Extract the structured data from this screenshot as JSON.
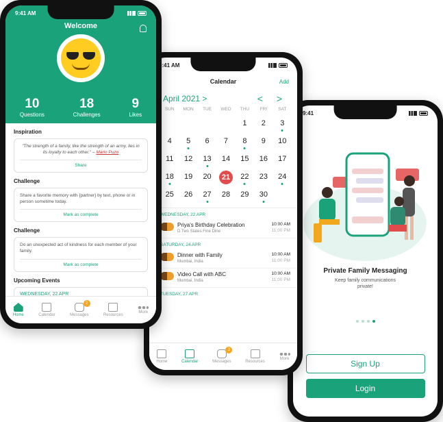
{
  "colors": {
    "accent": "#1aa37a",
    "today": "#e24b4b",
    "badge": "#f5a623"
  },
  "phone1": {
    "status_time": "9:41 AM",
    "title": "Welcome",
    "stats": [
      {
        "value": "10",
        "label": "Questions"
      },
      {
        "value": "18",
        "label": "Challenges"
      },
      {
        "value": "9",
        "label": "Likes"
      }
    ],
    "inspiration": {
      "heading": "Inspiration",
      "quote": "\"The strength of a family, like the strength of an army, lies in its loyalty to each other.\" – ",
      "author": "Mario Puzo",
      "action": "Share"
    },
    "challenge1": {
      "heading": "Challenge",
      "text": "Share a favorite memory with {partner} by text, phone or in person sometime today.",
      "action": "Mark as complete"
    },
    "challenge2": {
      "heading": "Challenge",
      "text": "Do an unexpected act of kindness for each member of your family.",
      "action": "Mark as complete"
    },
    "upcoming": {
      "heading": "Upcoming Events",
      "date": "WEDNESDAY, 22 APR"
    }
  },
  "tabs": {
    "home": "Home",
    "calendar": "Calendar",
    "messages": "Messages",
    "resources": "Resources",
    "more": "More",
    "messages_badge": "2"
  },
  "phone2": {
    "status_time": "9:41 AM",
    "title": "Calendar",
    "add": "Add",
    "month": "April 2021 >",
    "arrows": "< >",
    "weekdays": [
      "SUN",
      "MON",
      "TUE",
      "WED",
      "THU",
      "FRI",
      "SAT"
    ],
    "days": [
      "",
      "",
      "",
      "",
      "1",
      "2",
      "3",
      "4",
      "5",
      "6",
      "7",
      "8",
      "9",
      "10",
      "11",
      "12",
      "13",
      "14",
      "15",
      "16",
      "17",
      "18",
      "19",
      "20",
      "21",
      "22",
      "23",
      "24",
      "25",
      "26",
      "27",
      "28",
      "29",
      "30",
      ""
    ],
    "today": "21",
    "event_days": [
      "3",
      "5",
      "8",
      "13",
      "18",
      "22",
      "24",
      "27",
      "30"
    ],
    "sections": [
      {
        "date": "WEDNESDAY, 22 APR",
        "events": [
          {
            "title": "Priya's Birthday Celebration",
            "place": "D Two States Fine Dine",
            "start": "10:00 AM",
            "end": "11:00 PM"
          }
        ]
      },
      {
        "date": "SATURDAY, 24 APR",
        "events": [
          {
            "title": "Dinner with Family",
            "place": "Mumbai, India",
            "start": "10:00 AM",
            "end": "11:00 PM"
          },
          {
            "title": "Video Call with ABC",
            "place": "Mumbai, India",
            "start": "10:00 AM",
            "end": "11:00 PM"
          }
        ]
      },
      {
        "date": "TUESDAY, 27 APR",
        "events": []
      }
    ]
  },
  "phone3": {
    "status_time": "9:41",
    "title": "Private Family Messaging",
    "subtitle": "Keep family communications private!",
    "signup": "Sign Up",
    "login": "Login"
  }
}
